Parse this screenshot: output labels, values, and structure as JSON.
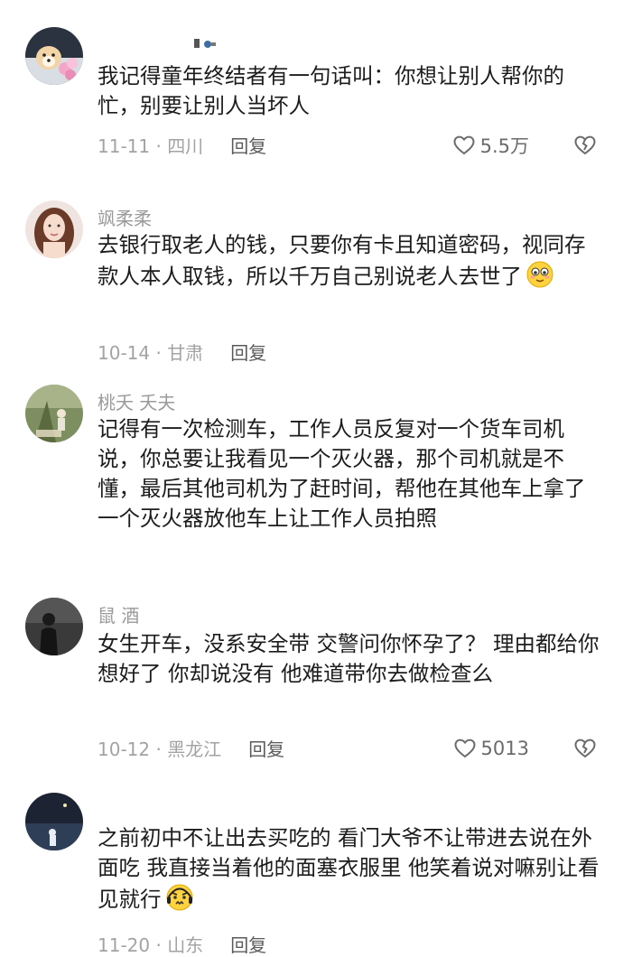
{
  "comments": [
    {
      "username": "",
      "username_badge": "toy-icon",
      "text": "我记得童年终结者有一句话叫：你想让别人帮你的忙，别要让别人当坏人",
      "date_loc": "11-11 · 四川",
      "reply": "回复",
      "likes": "5.5万"
    },
    {
      "username": "飒柔柔",
      "text": "去银行取老人的钱，只要你有卡且知道密码，视同存款人本人取钱，所以千万自己别说老人去世了",
      "emoji": "smiling-face-icon",
      "date_loc": "10-14 · 甘肃",
      "reply": "回复"
    },
    {
      "username": "桃夭  夭夫",
      "text": "记得有一次检测车，工作人员反复对一个货车司机说，你总要让我看见一个灭火器，那个司机就是不懂，最后其他司机为了赶时间，帮他在其他车上拿了一个灭火器放他车上让工作人员拍照"
    },
    {
      "username": "鼠  酒",
      "text": "女生开车，没系安全带 交警问你怀孕了？ 理由都给你想好了 你却说没有 他难道带你去做检查么",
      "date_loc": "10-12 · 黑龙江",
      "reply": "回复",
      "likes": "5013"
    },
    {
      "username": "",
      "text": "之前初中不让出去买吃的 看门大爷不让带进去说在外面吃 我直接当着他的面塞衣服里 他笑着说对嘛别让看见就行",
      "emoji": "worried-face-icon",
      "date_loc": "11-20 · 山东",
      "reply": "回复"
    }
  ],
  "colors": {
    "text": "#1c1c1c",
    "meta": "#a3a3a3",
    "reply": "#5a5a5a"
  }
}
